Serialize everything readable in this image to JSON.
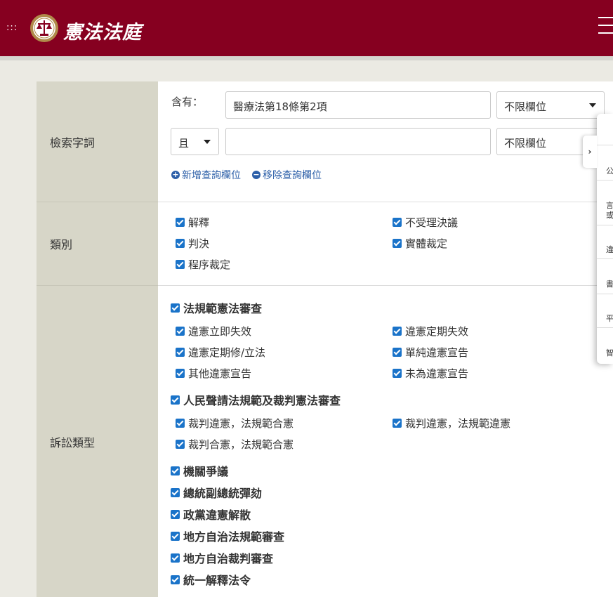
{
  "header": {
    "title": "憲法法庭",
    "menu_dots": ":::"
  },
  "form": {
    "handle_dots": ":::",
    "search": {
      "label": "檢索字詞",
      "contains_label": "含有：",
      "term1_value": "醫療法第18條第2項",
      "field1_value": "不限欄位",
      "operator_value": "且",
      "term2_value": "",
      "field2_value": "不限欄位",
      "add_field_label": "新增查詢欄位",
      "remove_field_label": "移除查詢欄位"
    },
    "category": {
      "label": "類別",
      "items": [
        "解釋",
        "不受理決議",
        "判決",
        "實體裁定",
        "程序裁定"
      ]
    },
    "case_type": {
      "label": "訴訟類型",
      "group1": {
        "title": "法規範憲法審查",
        "items": [
          "違憲立即失效",
          "違憲定期失效",
          "違憲定期修/立法",
          "單純違憲宣告",
          "其他違憲宣告",
          "未為違憲宣告"
        ]
      },
      "group2": {
        "title": "人民聲請法規範及裁判憲法審查",
        "items": [
          "裁判違憲，法規範合憲",
          "裁判違憲，法規範違憲",
          "裁判合憲，法規範合憲"
        ]
      },
      "others": [
        "機關爭議",
        "總統副總統彈劾",
        "政黨違憲解散",
        "地方自治法規範審查",
        "地方自治裁判審查",
        "統一解釋法令"
      ]
    }
  },
  "side_panel": {
    "toggle": "›",
    "items": [
      "公",
      "言",
      "違",
      "書",
      "平",
      "智"
    ],
    "item2_extra": "或"
  },
  "colors": {
    "brand": "#860020",
    "label_bg": "#d7d6c8",
    "checkbox": "#1a73c9",
    "link": "#2c5fa8"
  }
}
